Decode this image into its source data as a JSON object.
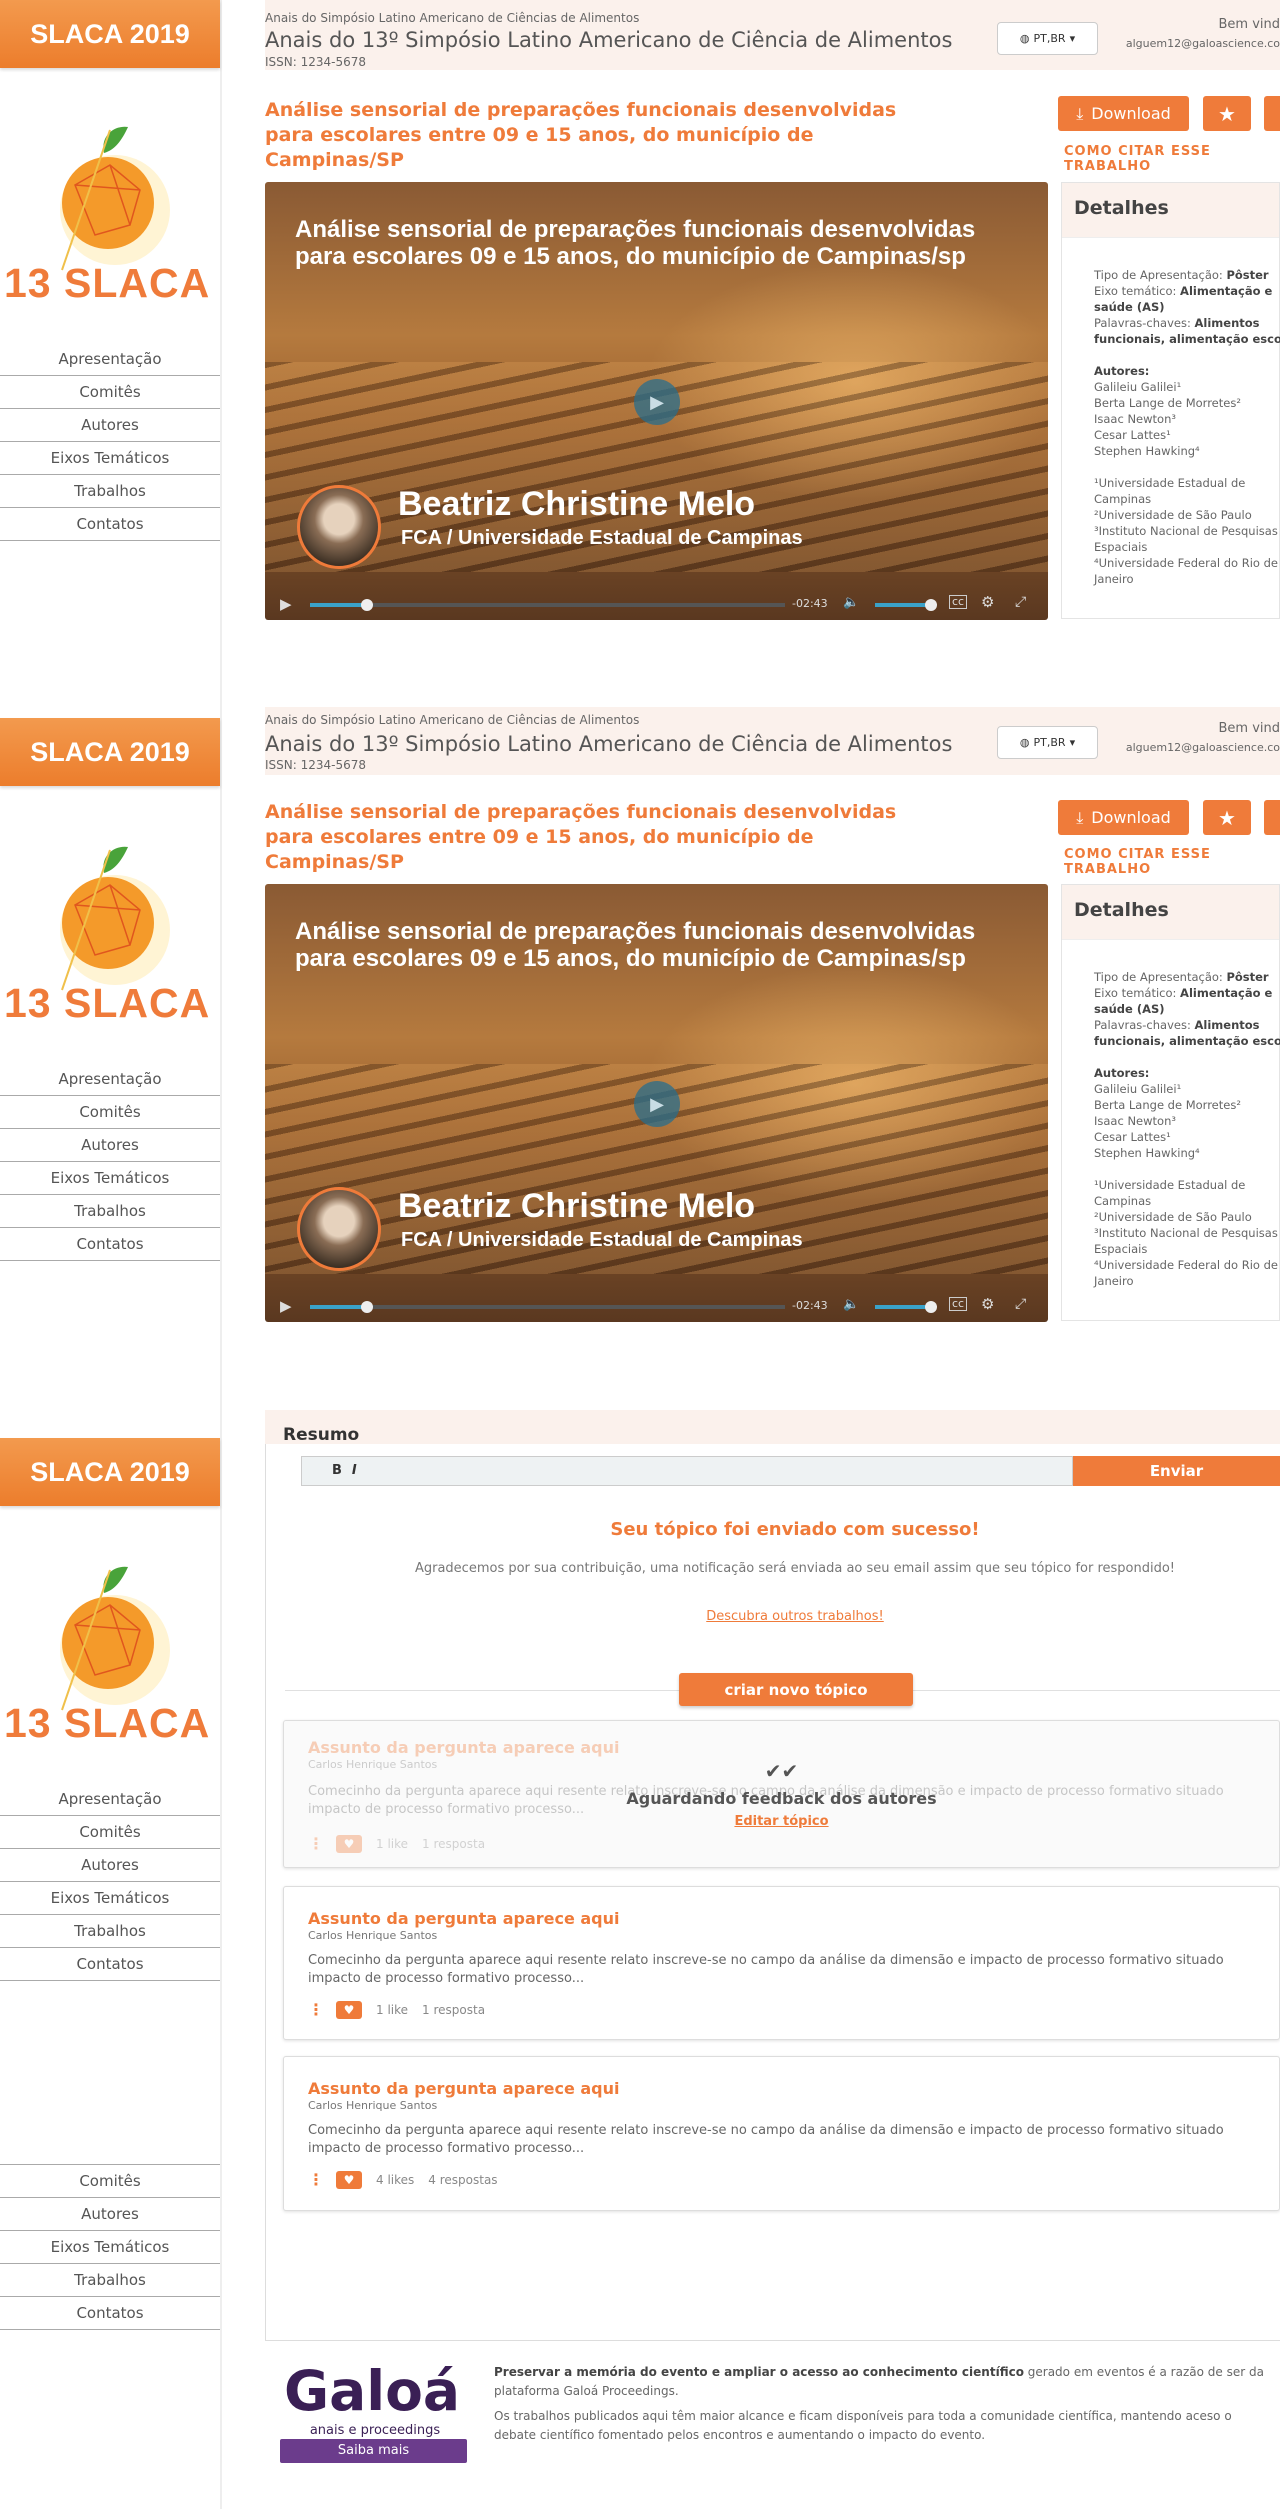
{
  "sidebar": {
    "badge": "SLACA 2019",
    "logo_text": "13 SLACA",
    "nav": [
      "Apresentação",
      "Comitês",
      "Autores",
      "Eixos Temáticos",
      "Trabalhos",
      "Contatos"
    ],
    "nav_bottom": [
      "Comitês",
      "Autores",
      "Eixos Temáticos",
      "Trabalhos",
      "Contatos"
    ]
  },
  "header": {
    "supertitle": "Anais do Simpósio Latino Americano de Ciências de Alimentos",
    "title": "Anais do 13º Simpósio Latino Americano de Ciência de Alimentos",
    "issn": "ISSN: 1234-5678",
    "lang": "PT,BR",
    "welcome": "Bem vind",
    "email": "alguem12@galoascience.co"
  },
  "paper": {
    "title": "Análise sensorial de preparações funcionais desenvolvidas para escolares entre 09 e 15 anos, do município de Campinas/SP",
    "download": "Download",
    "cite": "COMO CITAR ESSE TRABALHO"
  },
  "video1": {
    "title": "Análise sensorial de preparações funcionais desenvolvidas para escolares 09 e 15 anos, do município de Campinas/sp",
    "speaker": "Beatriz Christine Melo",
    "affiliation": "FCA / Universidade Estadual de Campinas",
    "time": "-02:43"
  },
  "video2": {
    "title": "Análise sensorial de preparações funcionais desenvolvidas para escolares 09 e 15 anos, do município de Campinas/sp",
    "speaker": "Beatriz Christine Melo",
    "affiliation": "FCA / Universidade Estadual de Campinas",
    "time": "-02:43"
  },
  "details": {
    "heading": "Detalhes",
    "type_label": "Tipo de Apresentação:",
    "type_value": "Pôster",
    "axis_label": "Eixo temático:",
    "axis_value": "Alimentação e",
    "axis_value2": "saúde (AS)",
    "kw_label": "Palavras-chaves:",
    "kw_value": "Alimentos",
    "kw_value2": "funcionais, alimentação escola",
    "authors_label": "Autores:",
    "authors": [
      "Galileiu Galilei¹",
      "Berta Lange de Morretes²",
      "Isaac Newton³",
      "Cesar Lattes¹",
      "Stephen Hawking⁴"
    ],
    "affiliations": [
      "¹Universidade Estadual de",
      "Campinas",
      "²Universidade de São Paulo",
      "³Instituto Nacional de Pesquisas",
      "Espaciais",
      "⁴Universidade Federal do Rio de",
      "Janeiro"
    ]
  },
  "resumo": {
    "heading": "Resumo",
    "bold": "B",
    "italic": "I",
    "send": "Enviar",
    "success_title": "Seu tópico foi enviado com sucesso!",
    "success_text": "Agradecemos por sua contribuição, uma notificação será enviada ao seu email assim que seu tópico for respondido!",
    "discover": "Descubra outros trabalhos!",
    "new_topic": "criar novo tópico",
    "pending_title": "Aguardando feedback dos autores",
    "edit_topic": "Editar tópico",
    "topics": [
      {
        "question": "Assunto da pergunta aparece aqui",
        "author": "Carlos Henrique Santos",
        "text": "Comecinho da pergunta aparece aqui resente relato inscreve-se no campo da análise da dimensão e impacto de processo formativo situado impacto de processo formativo processo...",
        "likes": "1 like",
        "replies": "1 resposta"
      },
      {
        "question": "Assunto da pergunta aparece aqui",
        "author": "Carlos Henrique Santos",
        "text": "Comecinho da pergunta aparece aqui resente relato inscreve-se no campo da análise da dimensão e impacto de processo formativo situado impacto de processo formativo processo...",
        "likes": "1 like",
        "replies": "1 resposta"
      },
      {
        "question": "Assunto da pergunta aparece aqui",
        "author": "Carlos Henrique Santos",
        "text": "Comecinho da pergunta aparece aqui resente relato inscreve-se no campo da análise da dimensão e impacto de processo formativo situado impacto de processo formativo processo...",
        "likes": "4 likes",
        "replies": "4 respostas"
      }
    ]
  },
  "footer": {
    "brand": "Galoá",
    "sub": "anais e proceedings",
    "more": "Saiba mais",
    "p1_bold": "Preservar a memória do evento e ampliar o acesso ao conhecimento científico",
    "p1_rest": " gerado em eventos é a razão de ser da plataforma Galoá Proceedings.",
    "p2": "Os trabalhos publicados aqui têm maior alcance e ficam disponíveis para toda a comunidade científica, mantendo aceso o debate científico fomentado pelos encontros e aumentando o impacto do evento."
  },
  "colors": {
    "accent": "#ef7b3a",
    "brand_purple": "#3a1f55",
    "header_bg": "#fbf1ec"
  }
}
